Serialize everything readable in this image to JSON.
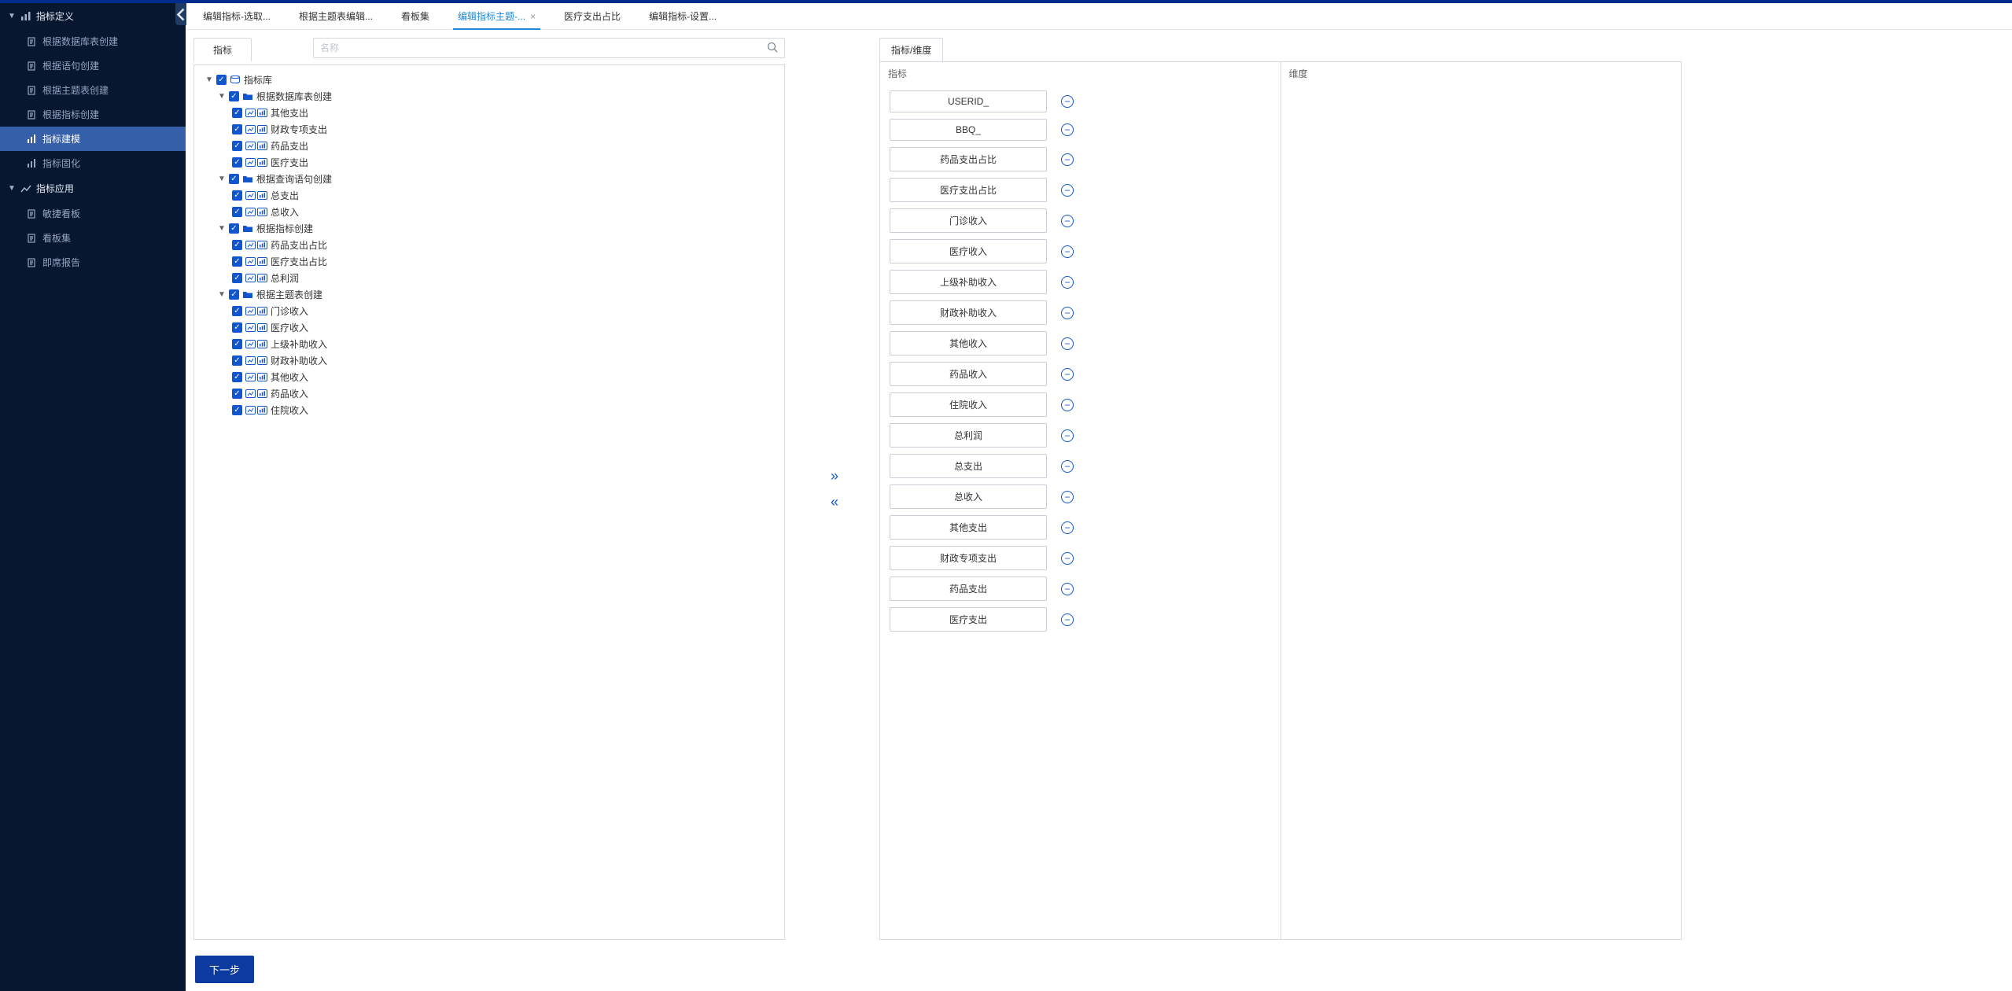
{
  "sidebar": {
    "groups": [
      {
        "label": "指标定义",
        "items": [
          {
            "label": "根据数据库表创建"
          },
          {
            "label": "根据语句创建"
          },
          {
            "label": "根据主题表创建"
          },
          {
            "label": "根据指标创建"
          },
          {
            "label": "指标建模",
            "active": true
          },
          {
            "label": "指标固化"
          }
        ]
      },
      {
        "label": "指标应用",
        "items": [
          {
            "label": "敏捷看板"
          },
          {
            "label": "看板集"
          },
          {
            "label": "即席报告"
          }
        ]
      }
    ]
  },
  "tabs": [
    {
      "label": "编辑指标-选取..."
    },
    {
      "label": "根据主题表编辑..."
    },
    {
      "label": "看板集"
    },
    {
      "label": "编辑指标主题-...",
      "active": true,
      "closable": true
    },
    {
      "label": "医疗支出占比"
    },
    {
      "label": "编辑指标-设置..."
    }
  ],
  "leftPanel": {
    "tab": "指标",
    "searchPlaceholder": "名称",
    "tree": {
      "root": {
        "label": "指标库"
      },
      "folders": [
        {
          "label": "根据数据库表创建",
          "items": [
            "其他支出",
            "财政专项支出",
            "药品支出",
            "医疗支出"
          ]
        },
        {
          "label": "根据查询语句创建",
          "items": [
            "总支出",
            "总收入"
          ]
        },
        {
          "label": "根据指标创建",
          "items": [
            "药品支出占比",
            "医疗支出占比",
            "总利润"
          ]
        },
        {
          "label": "根据主题表创建",
          "items": [
            "门诊收入",
            "医疗收入",
            "上级补助收入",
            "财政补助收入",
            "其他收入",
            "药品收入",
            "住院收入"
          ]
        }
      ]
    }
  },
  "transfer": {
    "add": "»",
    "remove": "«"
  },
  "rightPanel": {
    "tab": "指标/维度",
    "col1Header": "指标",
    "col2Header": "维度",
    "items": [
      "USERID_",
      "BBQ_",
      "药品支出占比",
      "医疗支出占比",
      "门诊收入",
      "医疗收入",
      "上级补助收入",
      "财政补助收入",
      "其他收入",
      "药品收入",
      "住院收入",
      "总利润",
      "总支出",
      "总收入",
      "其他支出",
      "财政专项支出",
      "药品支出",
      "医疗支出"
    ]
  },
  "footer": {
    "next": "下一步"
  }
}
